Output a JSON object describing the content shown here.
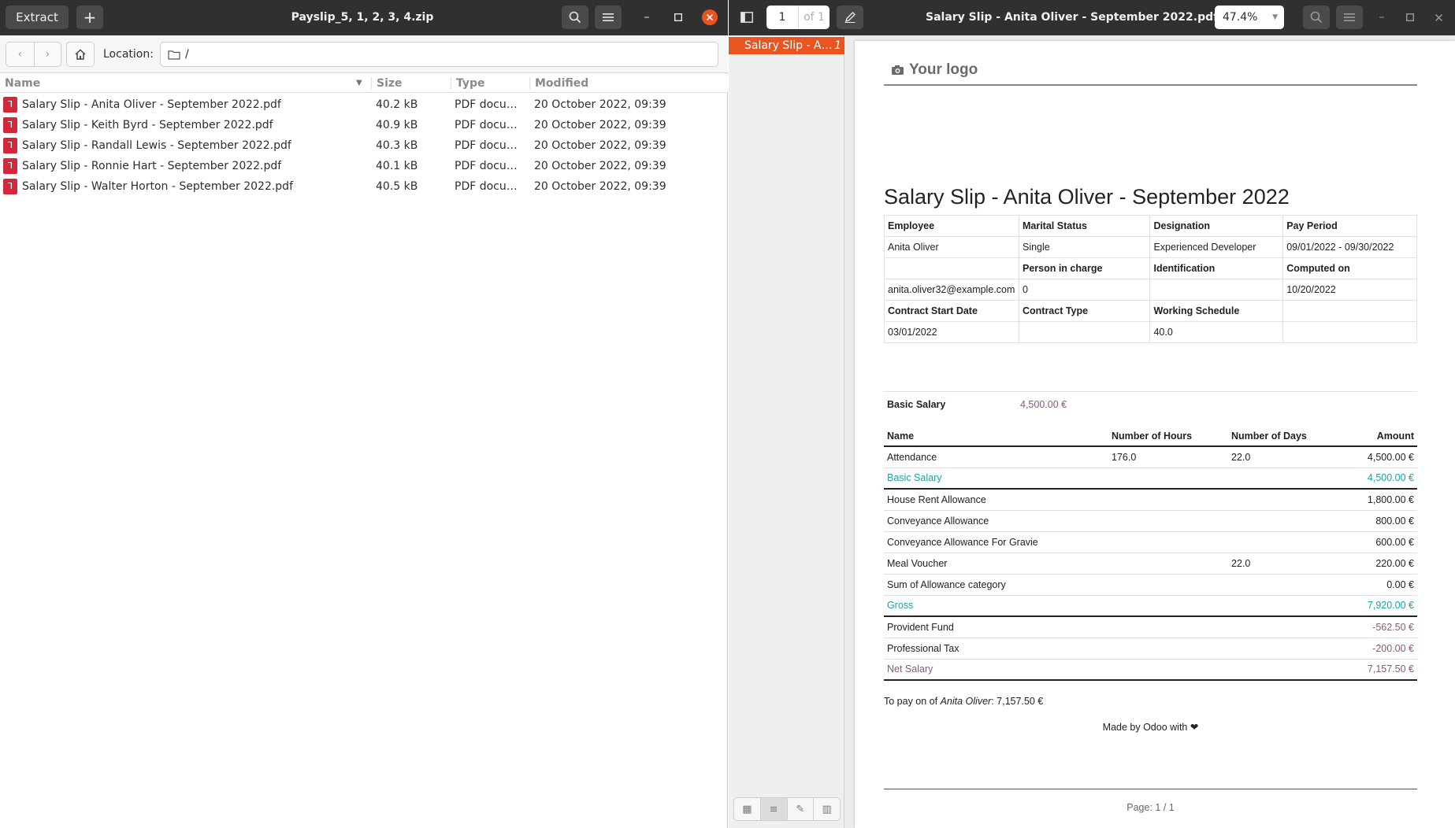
{
  "archive": {
    "title": "Payslip_5, 1, 2, 3, 4.zip",
    "extract_label": "Extract",
    "add_label": "+",
    "location_label": "Location:",
    "location_value": "/",
    "columns": {
      "name": "Name",
      "size": "Size",
      "type": "Type",
      "modified": "Modified"
    },
    "files": [
      {
        "name": "Salary Slip - Anita Oliver - September 2022.pdf",
        "size": "40.2 kB",
        "type": "PDF docum…",
        "modified": "20 October 2022, 09:39"
      },
      {
        "name": "Salary Slip - Keith Byrd - September 2022.pdf",
        "size": "40.9 kB",
        "type": "PDF docum…",
        "modified": "20 October 2022, 09:39"
      },
      {
        "name": "Salary Slip - Randall Lewis - September 2022.pdf",
        "size": "40.3 kB",
        "type": "PDF docum…",
        "modified": "20 October 2022, 09:39"
      },
      {
        "name": "Salary Slip - Ronnie Hart - September 2022.pdf",
        "size": "40.1 kB",
        "type": "PDF docum…",
        "modified": "20 October 2022, 09:39"
      },
      {
        "name": "Salary Slip - Walter Horton - September 2022.pdf",
        "size": "40.5 kB",
        "type": "PDF docum…",
        "modified": "20 October 2022, 09:39"
      }
    ]
  },
  "viewer": {
    "title": "Salary Slip - Anita Oliver - September 2022.pdf",
    "page_current": "1",
    "page_of": "of 1",
    "zoom": "47.4%",
    "sidebar_item": "Salary Slip - A…",
    "sidebar_item_num": "1"
  },
  "doc": {
    "logo": "Your logo",
    "title": "Salary Slip - Anita Oliver - September 2022",
    "info": {
      "employee_label": "Employee",
      "marital_label": "Marital Status",
      "designation_label": "Designation",
      "pay_period_label": "Pay Period",
      "employee": "Anita Oliver",
      "marital": "Single",
      "designation": "Experienced Developer",
      "pay_period": "09/01/2022 - 09/30/2022",
      "person_label": "Person in charge",
      "identification_label": "Identification",
      "computed_label": "Computed on",
      "email": "anita.oliver32@example.com",
      "person": "0",
      "identification": "",
      "computed": "10/20/2022",
      "start_label": "Contract Start Date",
      "ctype_label": "Contract Type",
      "schedule_label": "Working Schedule",
      "start": "03/01/2022",
      "ctype": "",
      "schedule": "40.0"
    },
    "basic_label": "Basic Salary",
    "basic_value": "4,500.00 €",
    "lines_header": {
      "name": "Name",
      "hours": "Number of Hours",
      "days": "Number of Days",
      "amount": "Amount"
    },
    "lines": [
      {
        "name": "Attendance",
        "hours": "176.0",
        "days": "22.0",
        "amount": "4,500.00 €",
        "kind": "normal"
      },
      {
        "name": "Basic Salary",
        "hours": "",
        "days": "",
        "amount": "4,500.00 €",
        "kind": "cat"
      },
      {
        "name": "House Rent Allowance",
        "hours": "",
        "days": "",
        "amount": "1,800.00 €",
        "kind": "normal"
      },
      {
        "name": "Conveyance Allowance",
        "hours": "",
        "days": "",
        "amount": "800.00 €",
        "kind": "normal"
      },
      {
        "name": "Conveyance Allowance For Gravie",
        "hours": "",
        "days": "",
        "amount": "600.00 €",
        "kind": "normal"
      },
      {
        "name": "Meal Voucher",
        "hours": "",
        "days": "22.0",
        "amount": "220.00 €",
        "kind": "normal"
      },
      {
        "name": "Sum of Allowance category",
        "hours": "",
        "days": "",
        "amount": "0.00 €",
        "kind": "normal"
      },
      {
        "name": "Gross",
        "hours": "",
        "days": "",
        "amount": "7,920.00 €",
        "kind": "cat"
      },
      {
        "name": "Provident Fund",
        "hours": "",
        "days": "",
        "amount": "-562.50 €",
        "kind": "neg"
      },
      {
        "name": "Professional Tax",
        "hours": "",
        "days": "",
        "amount": "-200.00 €",
        "kind": "neg"
      },
      {
        "name": "Net Salary",
        "hours": "",
        "days": "",
        "amount": "7,157.50 €",
        "kind": "net"
      }
    ],
    "to_pay_prefix": "To pay on of",
    "to_pay_name": "Anita Oliver",
    "to_pay_amount": ": 7,157.50 €",
    "made_by": "Made by Odoo with ❤",
    "footer": "Page: 1 / 1"
  },
  "colors": {
    "accent": "#e95420",
    "header": "#303030",
    "odoo_purple": "#875a7b",
    "category_teal": "#17a2a8",
    "pdf_red": "#d3283b"
  }
}
